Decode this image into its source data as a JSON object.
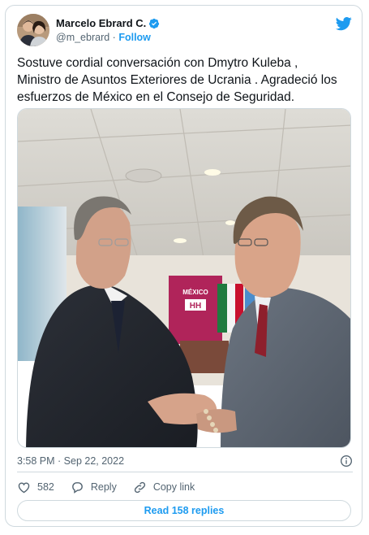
{
  "author": {
    "name": "Marcelo Ebrard C.",
    "handle": "@m_ebrard",
    "separator": "·",
    "follow_label": "Follow"
  },
  "tweet": {
    "lines": [
      "Sostuve cordial conversación con Dmytro Kuleba ,",
      "Ministro de Asuntos Exteriores de Ucrania . Agradeció los",
      "esfuerzos de México en el Consejo de Seguridad."
    ]
  },
  "photo": {
    "banner_title": "MÉXICO",
    "banner_logo": "HH"
  },
  "meta": {
    "timestamp": "3:58 PM · Sep 22, 2022"
  },
  "actions": {
    "likes_count": "582",
    "reply_label": "Reply",
    "copy_link_label": "Copy link"
  },
  "read_replies_label": "Read 158 replies",
  "colors": {
    "accent": "#1d9bf0",
    "like": "#536471",
    "border": "#cfd9de"
  },
  "icons": [
    "verified-badge-icon",
    "twitter-bird-icon",
    "info-icon",
    "heart-icon",
    "reply-icon",
    "link-icon"
  ]
}
